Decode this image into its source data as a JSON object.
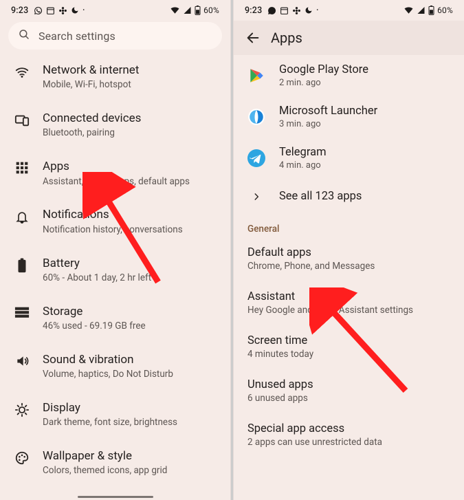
{
  "status": {
    "time": "9:23",
    "battery_text": "60%"
  },
  "left": {
    "search_label": "Search settings",
    "items": [
      {
        "title": "Network & internet",
        "sub": "Mobile, Wi-Fi, hotspot"
      },
      {
        "title": "Connected devices",
        "sub": "Bluetooth, pairing"
      },
      {
        "title": "Apps",
        "sub": "Assistant, recent apps, default apps"
      },
      {
        "title": "Notifications",
        "sub": "Notification history, conversations"
      },
      {
        "title": "Battery",
        "sub": "60% - About 1 day, 2 hr left"
      },
      {
        "title": "Storage",
        "sub": "46% used - 69.19 GB free"
      },
      {
        "title": "Sound & vibration",
        "sub": "Volume, haptics, Do Not Disturb"
      },
      {
        "title": "Display",
        "sub": "Dark theme, font size, brightness"
      },
      {
        "title": "Wallpaper & style",
        "sub": "Colors, themed icons, app grid"
      }
    ]
  },
  "right": {
    "header_title": "Apps",
    "apps": [
      {
        "name": "Google Play Store",
        "sub": "2 min. ago"
      },
      {
        "name": "Microsoft Launcher",
        "sub": "3 min. ago"
      },
      {
        "name": "Telegram",
        "sub": "4 min. ago"
      }
    ],
    "see_all": "See all 123 apps",
    "section_label": "General",
    "general": [
      {
        "title": "Default apps",
        "sub": "Chrome, Phone, and Messages"
      },
      {
        "title": "Assistant",
        "sub": "Hey Google and other Assistant settings"
      },
      {
        "title": "Screen time",
        "sub": "4 minutes today"
      },
      {
        "title": "Unused apps",
        "sub": "6 unused apps"
      },
      {
        "title": "Special app access",
        "sub": "2 apps can use unrestricted data"
      }
    ]
  }
}
